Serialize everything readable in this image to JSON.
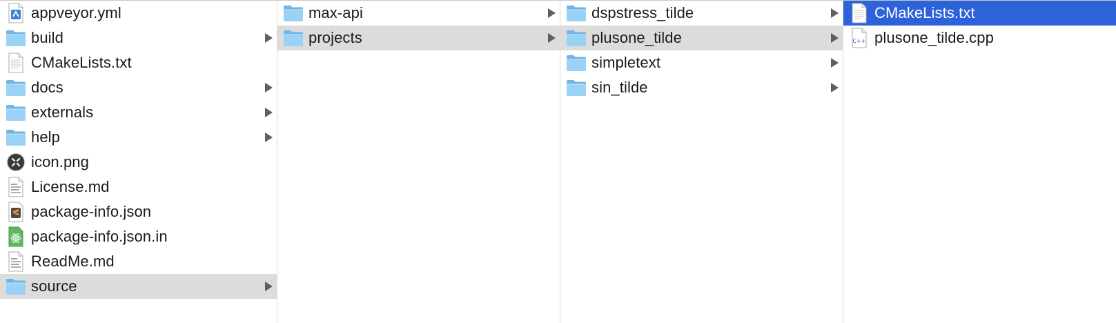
{
  "columns": [
    {
      "items": [
        {
          "name": "appveyor.yml",
          "icon": "yml-document-icon",
          "folder": false,
          "selected": "none"
        },
        {
          "name": "build",
          "icon": "folder-icon",
          "folder": true,
          "selected": "none"
        },
        {
          "name": "CMakeLists.txt",
          "icon": "text-document-icon",
          "folder": false,
          "selected": "none"
        },
        {
          "name": "docs",
          "icon": "folder-icon",
          "folder": true,
          "selected": "none"
        },
        {
          "name": "externals",
          "icon": "folder-icon",
          "folder": true,
          "selected": "none"
        },
        {
          "name": "help",
          "icon": "folder-icon",
          "folder": true,
          "selected": "none"
        },
        {
          "name": "icon.png",
          "icon": "tools-image-icon",
          "folder": false,
          "selected": "none"
        },
        {
          "name": "License.md",
          "icon": "markdown-document-icon",
          "folder": false,
          "selected": "none"
        },
        {
          "name": "package-info.json",
          "icon": "sublime-document-icon",
          "folder": false,
          "selected": "none"
        },
        {
          "name": "package-info.json.in",
          "icon": "atom-document-icon",
          "folder": false,
          "selected": "none"
        },
        {
          "name": "ReadMe.md",
          "icon": "markdown-document-icon",
          "folder": false,
          "selected": "none"
        },
        {
          "name": "source",
          "icon": "folder-icon",
          "folder": true,
          "selected": "path"
        }
      ]
    },
    {
      "items": [
        {
          "name": "max-api",
          "icon": "folder-icon",
          "folder": true,
          "selected": "none"
        },
        {
          "name": "projects",
          "icon": "folder-icon",
          "folder": true,
          "selected": "path"
        }
      ]
    },
    {
      "items": [
        {
          "name": "dspstress_tilde",
          "icon": "folder-icon",
          "folder": true,
          "selected": "none"
        },
        {
          "name": "plusone_tilde",
          "icon": "folder-icon",
          "folder": true,
          "selected": "path"
        },
        {
          "name": "simpletext",
          "icon": "folder-icon",
          "folder": true,
          "selected": "none"
        },
        {
          "name": "sin_tilde",
          "icon": "folder-icon",
          "folder": true,
          "selected": "none"
        }
      ]
    },
    {
      "items": [
        {
          "name": "CMakeLists.txt",
          "icon": "text-document-icon",
          "folder": false,
          "selected": "active"
        },
        {
          "name": "plusone_tilde.cpp",
          "icon": "cpp-document-icon",
          "folder": false,
          "selected": "none"
        }
      ]
    }
  ],
  "colors": {
    "selection_active": "#2d63d9",
    "selection_path": "#dcdcdc",
    "folder": "#8cc8f0",
    "arrow": "#5f5f5f"
  }
}
